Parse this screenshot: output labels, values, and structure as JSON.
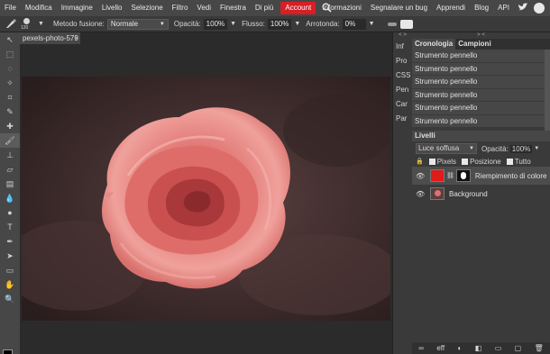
{
  "menu": {
    "items": [
      "File",
      "Modifica",
      "Immagine",
      "Livello",
      "Selezione",
      "Filtro",
      "Vedi",
      "Finestra",
      "Di più"
    ],
    "account": "Account",
    "right_items": [
      "Informazioni",
      "Segnalare un bug",
      "Apprendi",
      "Blog",
      "API"
    ],
    "account_color": "#d61f26"
  },
  "options": {
    "brush_size": "120",
    "blend_label": "Metodo fusione:",
    "blend_value": "Normale",
    "opacity_label": "Opacità:",
    "opacity_value": "100%",
    "flow_label": "Flusso:",
    "flow_value": "100%",
    "smooth_label": "Arrotonda:",
    "smooth_value": "0%"
  },
  "document": {
    "tab_title": "pexels-photo-579",
    "tab_close": "×"
  },
  "side_panel": [
    "Inf",
    "Pro",
    "CSS",
    "Pen",
    "Car",
    "Par"
  ],
  "history": {
    "tabs": [
      "Cronologia",
      "Campioni"
    ],
    "items": [
      "Strumento pennello",
      "Strumento pennello",
      "Strumento pennello",
      "Strumento pennello",
      "Strumento pennello",
      "Strumento pennello"
    ]
  },
  "layers": {
    "title": "Livelli",
    "blend_mode": "Luce soffusa",
    "opacity_label": "Opacità:",
    "opacity_value": "100%",
    "lock_pixels": "Pixels",
    "lock_position": "Posizione",
    "lock_all": "Tutto",
    "items": [
      {
        "name": "Riempimento di colore u",
        "fill_color": "#e11a1a"
      },
      {
        "name": "Background"
      }
    ],
    "bottom_icons": [
      "link-icon",
      "effects-icon",
      "adjustment-icon",
      "mask-icon",
      "folder-icon",
      "new-layer-icon",
      "trash-icon"
    ]
  },
  "colors": {
    "foreground": "#000000",
    "background": "#ffffff"
  }
}
